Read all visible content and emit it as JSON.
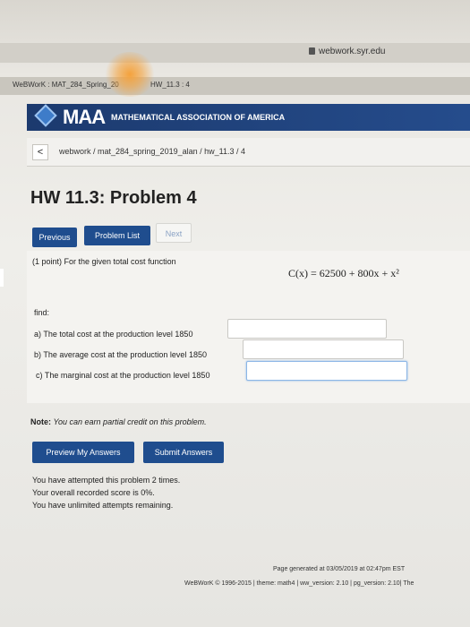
{
  "browser": {
    "url": "webwork.syr.edu",
    "tab_left": "WeBWorK : MAT_284_Spring_20",
    "tab_right": "HW_11.3 : 4"
  },
  "banner": {
    "logo": "MAA",
    "subtitle": "MATHEMATICAL ASSOCIATION OF AMERICA"
  },
  "breadcrumb": {
    "back_label": "<",
    "path": "webwork / mat_284_spring_2019_alan / hw_11.3 / 4"
  },
  "page_title": "HW 11.3: Problem 4",
  "nav": {
    "previous": "Previous",
    "problem_list": "Problem List",
    "next": "Next"
  },
  "problem": {
    "intro": "(1 point) For the given total cost function",
    "formula": "C(x) = 62500 + 800x + x²",
    "find": "find:",
    "parts": [
      {
        "label": "a) The total cost at the production level 1850",
        "value": ""
      },
      {
        "label": "b) The average cost at the production level 1850",
        "value": ""
      },
      {
        "label": "c) The marginal cost at the production level 1850",
        "value": ""
      }
    ]
  },
  "note": {
    "label": "Note:",
    "text": "You can earn partial credit on this problem."
  },
  "actions": {
    "preview": "Preview My Answers",
    "submit": "Submit Answers"
  },
  "status": {
    "line1": "You have attempted this problem 2 times.",
    "line2": "Your overall recorded score is 0%.",
    "line3": "You have unlimited attempts remaining."
  },
  "footer": {
    "generated": "Page generated at 03/05/2019 at 02:47pm EST",
    "copyright": "WeBWorK © 1996-2015 | theme: math4 | ww_version: 2.10 | pg_version: 2.10| The"
  },
  "colors": {
    "banner": "#1c3a6e",
    "button": "#1f4d8e",
    "glare": "#f4a23c"
  }
}
